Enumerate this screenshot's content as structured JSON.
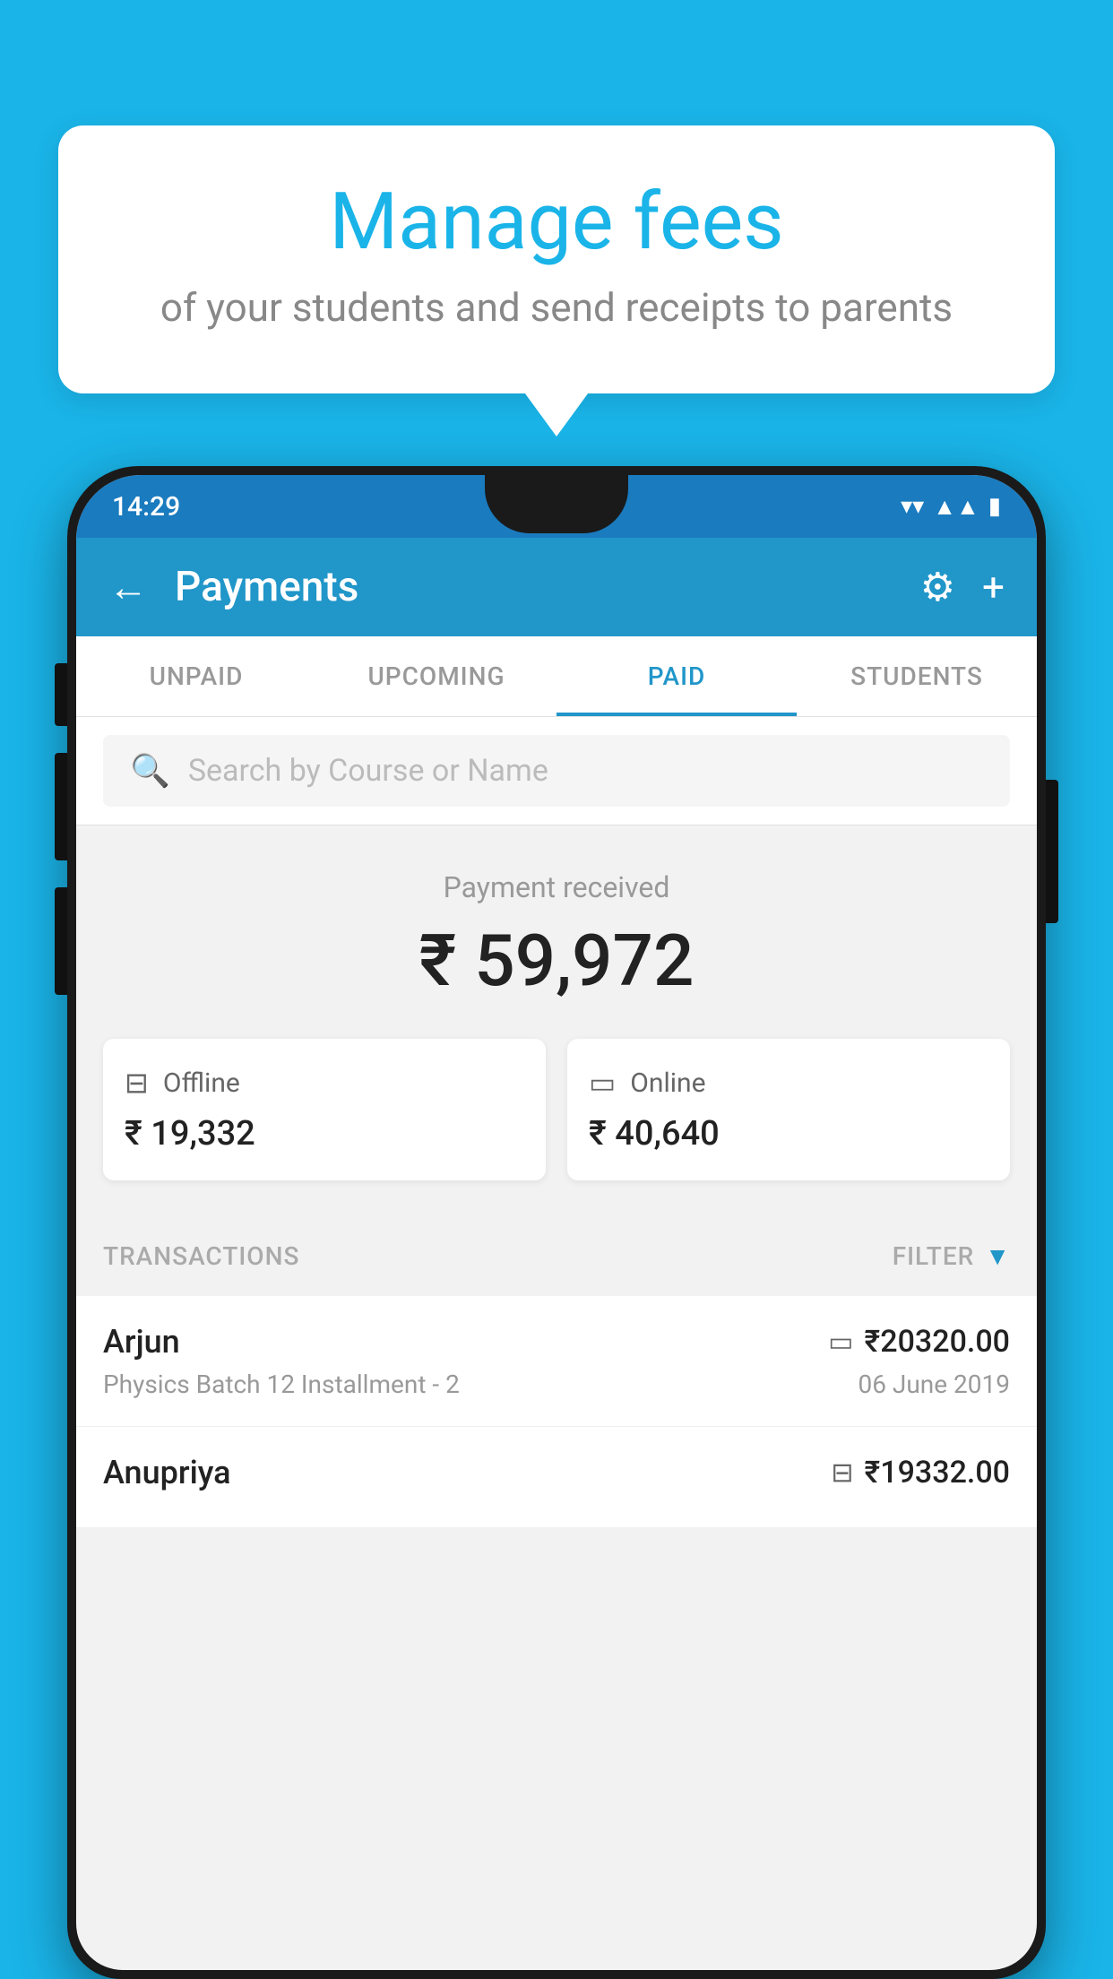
{
  "bubble": {
    "title": "Manage fees",
    "subtitle": "of your students and send receipts to parents"
  },
  "status_bar": {
    "time": "14:29",
    "wifi": "▼",
    "signal": "▲",
    "battery": "▮"
  },
  "app_bar": {
    "title": "Payments",
    "back_icon": "←",
    "gear_icon": "⚙",
    "plus_icon": "+"
  },
  "tabs": [
    {
      "label": "UNPAID",
      "active": false
    },
    {
      "label": "UPCOMING",
      "active": false
    },
    {
      "label": "PAID",
      "active": true
    },
    {
      "label": "STUDENTS",
      "active": false
    }
  ],
  "search": {
    "placeholder": "Search by Course or Name"
  },
  "payment_summary": {
    "label": "Payment received",
    "amount": "₹ 59,972",
    "offline": {
      "type": "Offline",
      "amount": "₹ 19,332"
    },
    "online": {
      "type": "Online",
      "amount": "₹ 40,640"
    }
  },
  "transactions": {
    "header_label": "TRANSACTIONS",
    "filter_label": "FILTER",
    "rows": [
      {
        "name": "Arjun",
        "course": "Physics Batch 12 Installment - 2",
        "amount": "₹20320.00",
        "date": "06 June 2019",
        "payment_type": "card"
      },
      {
        "name": "Anupriya",
        "course": "",
        "amount": "₹19332.00",
        "date": "",
        "payment_type": "offline"
      }
    ]
  }
}
